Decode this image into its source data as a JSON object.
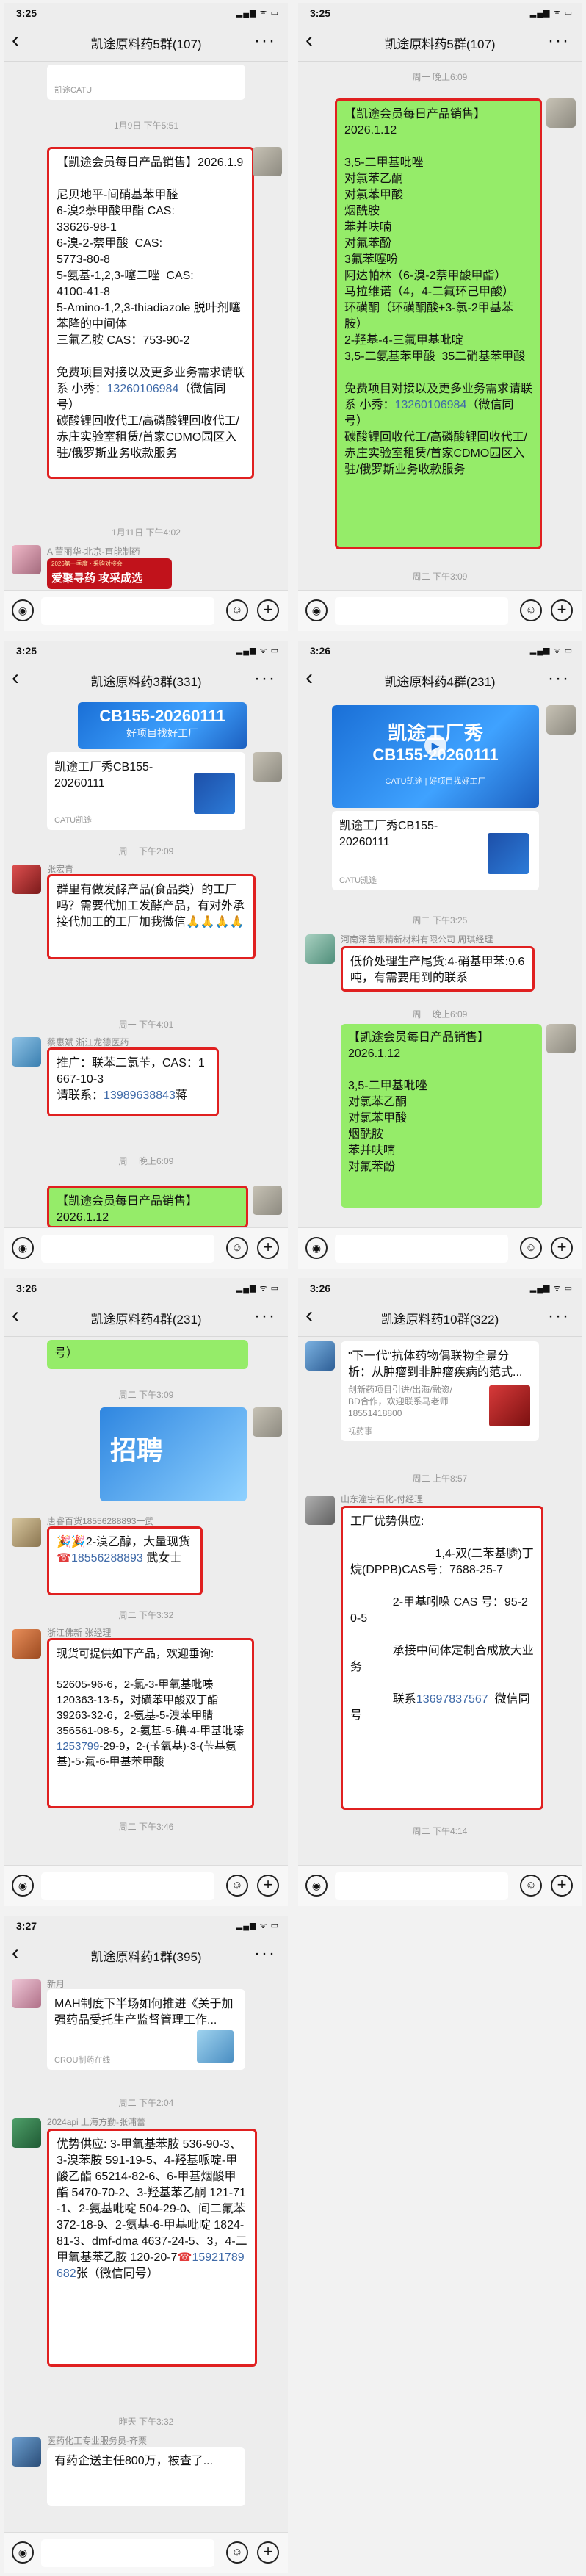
{
  "colors": {
    "chat_bg": "#ededed",
    "green_bubble": "#95ec69",
    "highlight": "#e02020",
    "link": "#3f6aa8"
  },
  "icons": {
    "back": "chevron-left-icon",
    "more": "more-icon",
    "voice": "voice-icon",
    "emoji": "emoji-icon",
    "plus": "plus-icon"
  },
  "panels": [
    {
      "time": "3:25",
      "title": "凯途原料药5群(107)",
      "card_foot": "凯途CATU",
      "ts1": "1月9日 下午5:51",
      "msg1": "【凯途会员每日产品销售】2026.1.9\n\n尼贝地平-间硝基苯甲醛\n6-溴2萘甲酸甲酯 CAS:\n33626-98-1\n6-溴-2-萘甲酸  CAS:\n5773-80-8\n5-氨基-1,2,3-噻二唑  CAS:\n4100-41-8\n5-Amino-1,2,3-thiadiazole 脱叶剂噻苯隆的中间体\n三氟乙胺 CAS：753-90-2\n\n免费项目对接以及更多业务需求请联系 小秀：",
      "phone1": "13260106984",
      "msg1b": "（微信同号）\n碳酸锂回收代工/高磷酸锂回收代工/赤庄实验室租赁/首家CDMO园区入驻/俄罗斯业务收款服务",
      "ts2": "1月11日 下午4:02",
      "sender2": "A 董丽华-北京-直能制药",
      "ad": "爱聚寻药 攻采成选",
      "ad_sub": "2026第一季度 · 采购对接会"
    },
    {
      "time": "3:25",
      "title": "凯途原料药5群(107)",
      "ts1": "周一 晚上6:09",
      "msg1": "【凯途会员每日产品销售】\n2026.1.12\n\n3,5-二甲基吡唑\n对氯苯乙酮\n对氯苯甲酸\n烟酰胺\n苯并呋喃\n对氟苯酚\n3氟苯噻吩\n阿达帕林（6-溴-2萘甲酸甲酯）\n马拉维诺（4，4-二氟环己甲酸）\n环磺酮（环磺酮酸+3-氯-2甲基苯胺）\n2-羟基-4-三氟甲基吡啶\n3,5-二氨基苯甲酸  35二硝基苯甲酸\n\n免费项目对接以及更多业务需求请联系 小秀：",
      "phone1": "13260106984",
      "msg1b": "（微信同号）\n碳酸锂回收代工/高磷酸锂回收代工/赤庄实验室租赁/首家CDMO园区入驻/俄罗斯业务收款服务",
      "ts2": "周二 下午3:09"
    },
    {
      "time": "3:25",
      "title": "凯途原料药3群(331)",
      "banner1": "CB155-20260111",
      "banner2": "好项目找好工厂",
      "card_title": "凯途工厂秀CB155-20260111",
      "card_foot": "CATU凯途",
      "ts1": "周一 下午2:09",
      "sender1": "张宏青",
      "msg1": "群里有做发酵产品(食品类）的工厂吗？需要代加工发酵产品，有对外承接代加工的工厂加我微信🙏🙏🙏🙏",
      "ts2": "周一 下午4:01",
      "sender2": "蔡惠斌 浙江龙德医药",
      "msg2": "推广：联苯二氯苄，CAS：1667-10-3\n请联系：",
      "phone2": "13989638843",
      "msg2b": "蒋",
      "ts3": "周一 晚上6:09",
      "msg3": "【凯途会员每日产品销售】\n2026.1.12"
    },
    {
      "time": "3:26",
      "title": "凯途原料药4群(231)",
      "banner1": "凯途工厂秀",
      "banner2": "CB155-20260111",
      "banner3": "CATU凯途 | 好项目找好工厂",
      "card_title": "凯途工厂秀CB155-20260111",
      "card_foot": "CATU凯途",
      "ts1": "周二 下午3:25",
      "sender1": "河南泽苗原精新材料有限公司 周琪经理",
      "msg1": "低价处理生产尾货:4-硝基甲苯:9.6吨，有需要用到的联系",
      "ts2": "周一 晚上6:09",
      "msg2": "【凯途会员每日产品销售】\n2026.1.12\n\n3,5-二甲基吡唑\n对氯苯乙酮\n对氯苯甲酸\n烟酰胺\n苯并呋喃\n对氟苯酚"
    },
    {
      "time": "3:26",
      "title": "凯途原料药4群(231)",
      "top_frag": "号）",
      "ts1": "周二 下午3:09",
      "recruit": "招聘",
      "sender1": "唐睿百货18556288893一武",
      "msg1": "🎉🎉2-溴乙醇，大量现货",
      "phone1": "18556288893",
      "msg1b": "武女士",
      "ts2": "周二 下午3:32",
      "sender2": "浙江佛新 张经理",
      "msg2": "现货可提供如下产品，欢迎垂询:\n\n52605-96-6，2-氯-3-甲氧基吡嗪\n120363-13-5，对磺苯甲酸双丁酯\n39263-32-6，2-氨基-5-溴苯甲腈\n356561-08-5，2-氨基-5-碘-4-甲基吡嗪\n",
      "phone2": "1253799",
      "msg2b": "-29-9，2-(苄氧基)-3-(苄基氨基)-5-氟-6-甲基苯甲酸",
      "ts3": "周二 下午3:46"
    },
    {
      "time": "3:26",
      "title": "凯途原料药10群(322)",
      "card_title": "\"下一代\"抗体药物偶联物全景分析：从肿瘤到非肿瘤疾病的范式...",
      "card_desc": "创新药项目引进/出海/融资/\nBD合作，欢迎联系马老师\n18551418800",
      "card_foot": "视药事",
      "ts1": "周二 上午8:57",
      "sender1": "山东潼宇石化-付经理",
      "msg1": "工厂优势供应:\n\n                          1,4-双(二苯基膦)丁烷(DPPB)CAS号：7688-25-7\n\n             2-甲基吲哚 CAS 号：95-20-5\n\n             承接中间体定制合成放大业务\n\n             联系",
      "phone1": "13697837567",
      "msg1b": "  微信同号",
      "ts2": "周二 下午4:14"
    },
    {
      "time": "3:27",
      "title": "凯途原料药1群(395)",
      "sender0": "新月",
      "card_title": "MAH制度下半场如何推进《关于加强药品受托生产监督管理工作...",
      "card_foot": "CROU制药在线",
      "ts1": "周二 下午2:04",
      "sender1": "2024api 上海方勤-张浦蕾",
      "msg1": "优势供应: 3-甲氧基苯胺 536-90-3、3-溴苯胺 591-19-5、4-羟基哌啶-甲酸乙酯 65214-82-6、6-甲基烟酸甲酯 5470-70-2、3-羟基苯乙酮 121-71-1、2-氨基吡啶 504-29-0、间二氟苯 372-18-9、2-氨基-6-甲基吡啶 1824-81-3、dmf-dma 4637-24-5、3，4-二甲氧基苯乙胺 120-20-7",
      "phone1": "15921789682",
      "msg1b": "张（微信同号）",
      "ts2": "昨天 下午3:32",
      "sender2": "医药化工专业服务员-齐栗",
      "msg2": "有药企送主任800万，被查了..."
    }
  ]
}
